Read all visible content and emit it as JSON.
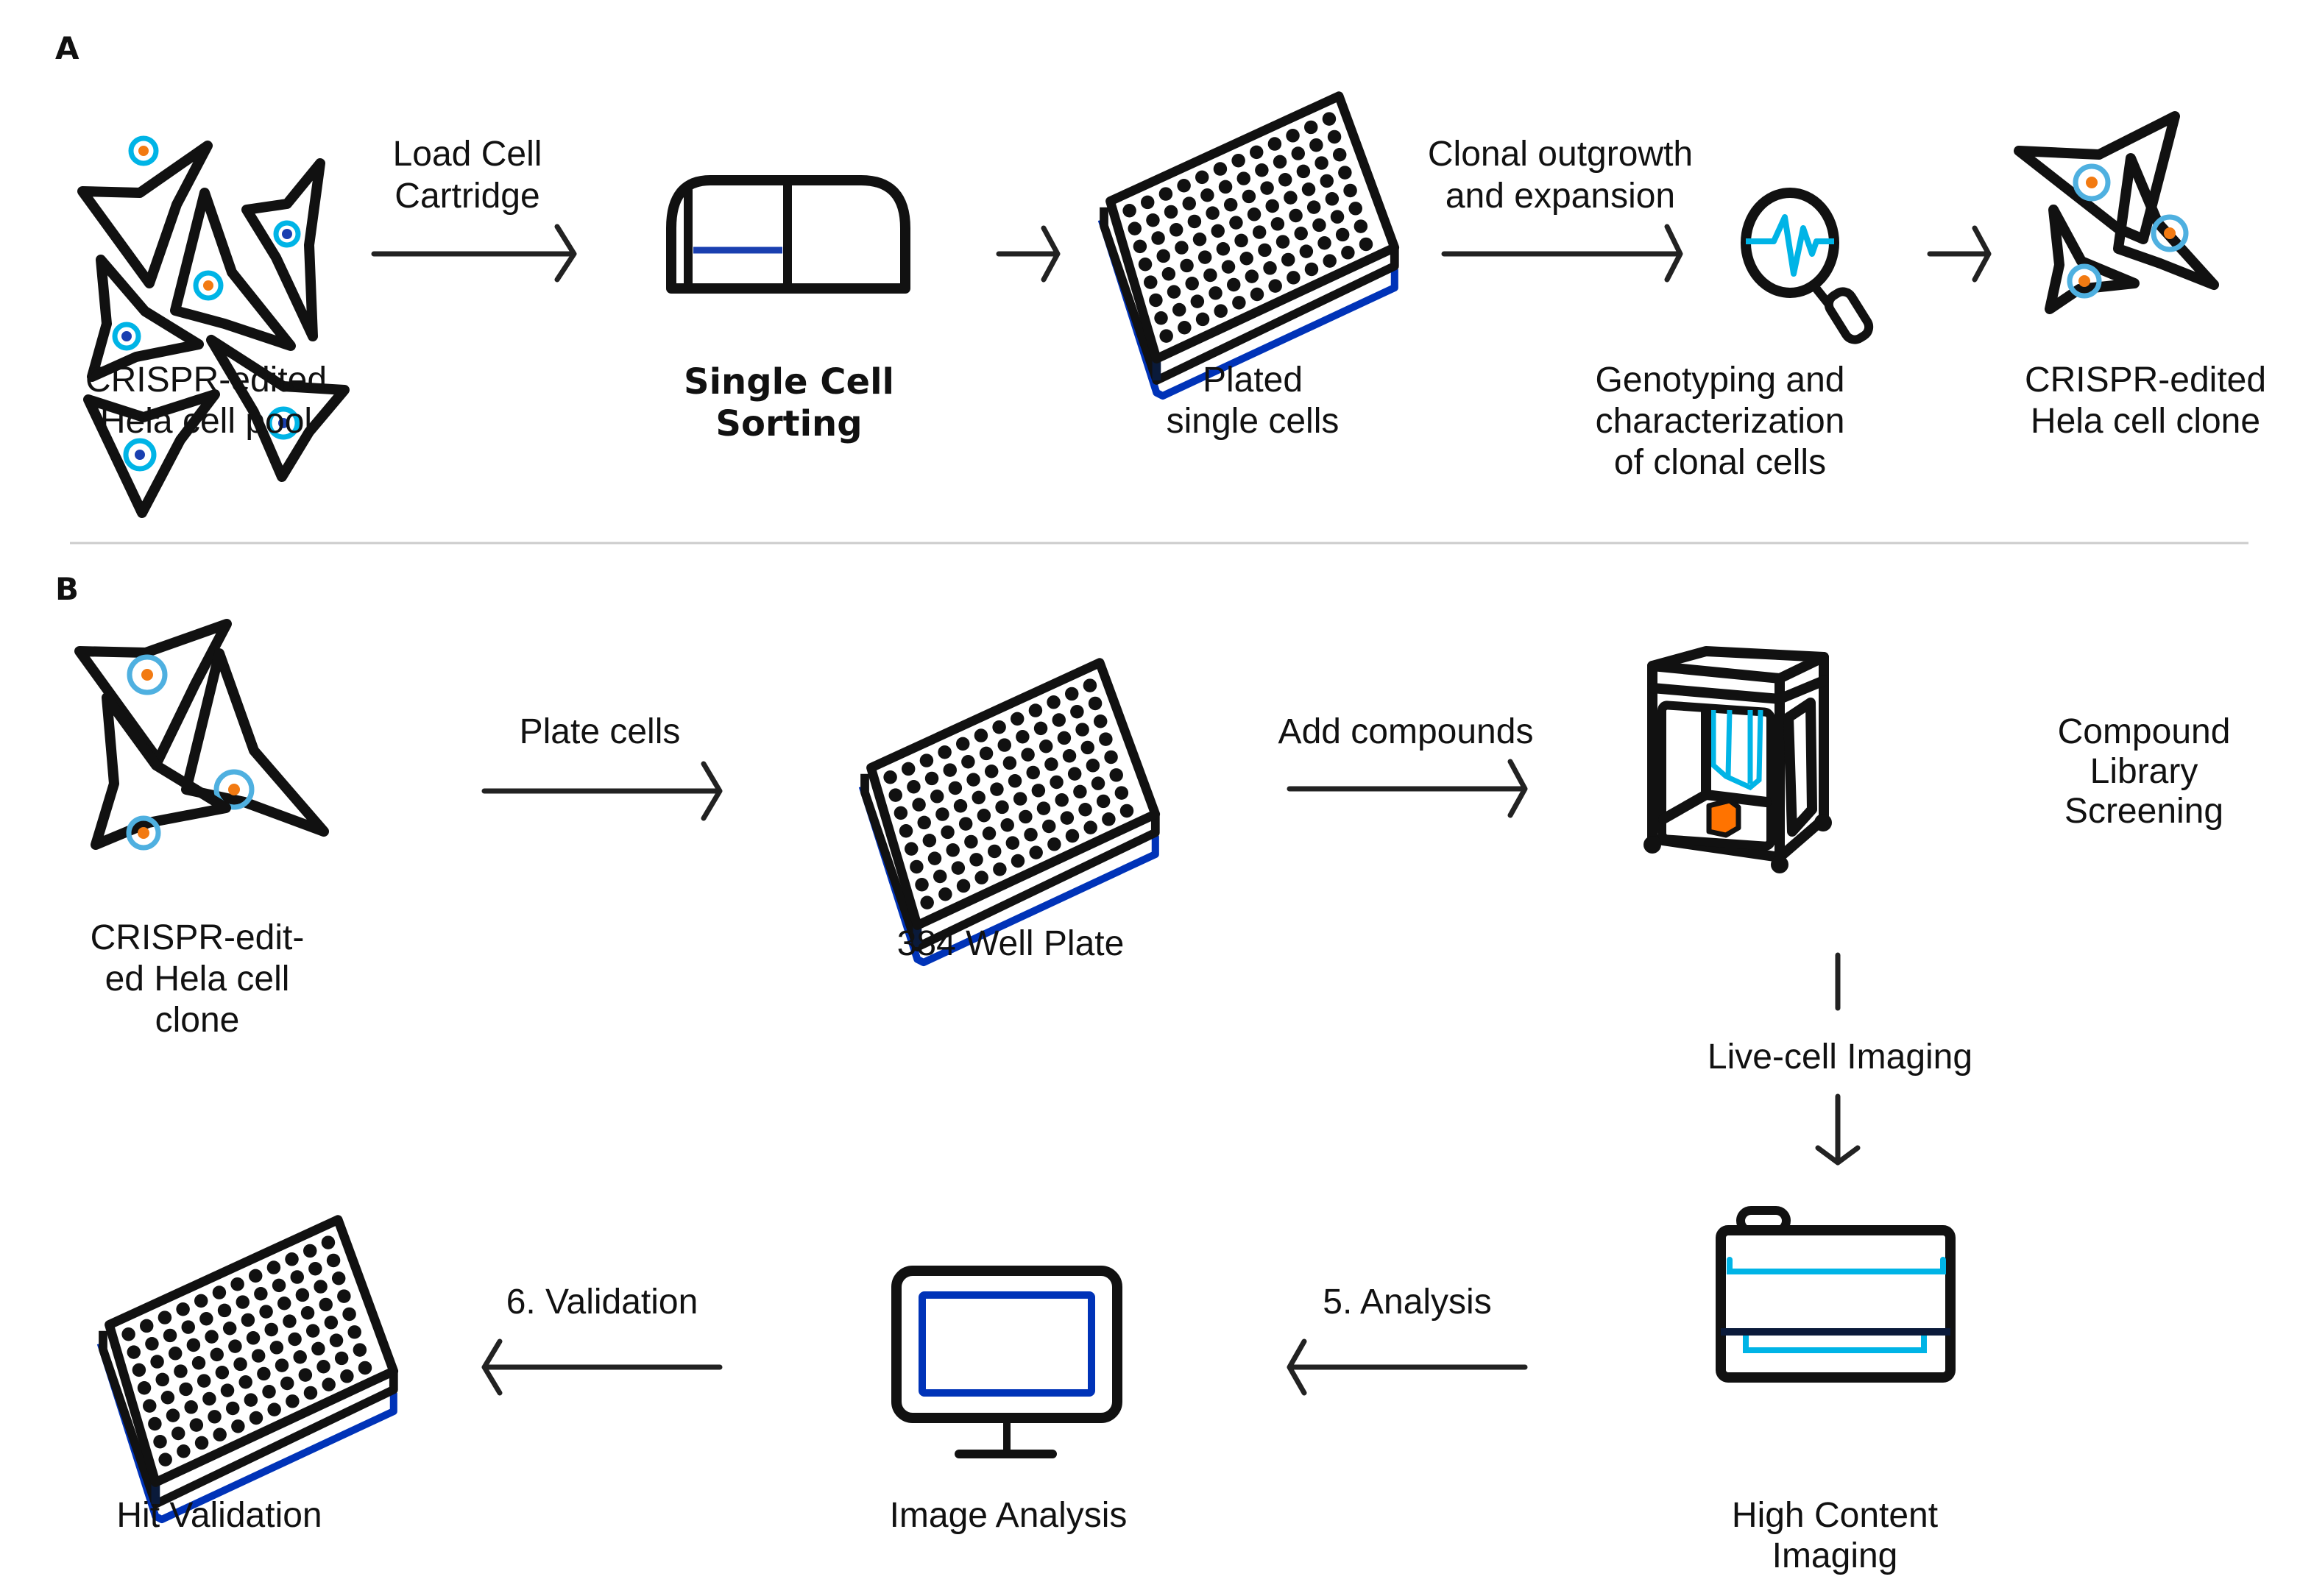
{
  "colors": {
    "ink": "#111111",
    "cyan": "#00b4e6",
    "nucleus_blue": "#1a3fb0",
    "nucleus_orange": "#f27a12",
    "plate_blue": "#0033b8",
    "box_orange": "#ff7300",
    "divider": "#cccccc"
  },
  "panel_a": {
    "label": "A",
    "steps": [
      {
        "icon": "cell-pool-icon",
        "lines": [
          "CRISPR-edited",
          "Hela cell pool"
        ]
      },
      {
        "icon": "cell-sorter-icon",
        "lines": [
          "Single Cell",
          "Sorting"
        ]
      },
      {
        "icon": "well-plate-icon",
        "lines": [
          "Plated",
          "single cells"
        ]
      },
      {
        "icon": "magnifier-waveform-icon",
        "lines": [
          "Genotyping and",
          "characterization",
          "of clonal cells"
        ]
      },
      {
        "icon": "cell-clone-icon",
        "lines": [
          "CRISPR-edited",
          "Hela cell clone"
        ]
      }
    ],
    "arrows": [
      {
        "lines": [
          "Load Cell",
          "Cartridge"
        ]
      },
      {
        "lines": []
      },
      {
        "lines": [
          "Clonal outgrowth",
          "and expansion"
        ]
      },
      {
        "lines": []
      }
    ]
  },
  "panel_b": {
    "label": "B",
    "steps": [
      {
        "icon": "cell-clone-icon",
        "lines": [
          "CRISPR-edit-",
          "ed Hela cell",
          "clone"
        ]
      },
      {
        "icon": "well-plate-icon",
        "lines": [
          "384 Well Plate"
        ]
      },
      {
        "icon": "liquid-handler-icon",
        "lines": [
          "Compound",
          "Library",
          "Screening"
        ]
      },
      {
        "icon": "imager-icon",
        "lines": [
          "High Content",
          "Imaging"
        ]
      },
      {
        "icon": "monitor-icon",
        "lines": [
          "Image Analysis"
        ]
      },
      {
        "icon": "well-plate-icon",
        "lines": [
          "Hit Validation"
        ]
      }
    ],
    "arrows": [
      {
        "lines": [
          "Plate cells"
        ]
      },
      {
        "lines": [
          "Add compounds"
        ]
      },
      {
        "lines": [
          "Live-cell Imaging"
        ]
      },
      {
        "lines": [
          "5. Analysis"
        ]
      },
      {
        "lines": [
          "6. Validation"
        ]
      }
    ]
  }
}
